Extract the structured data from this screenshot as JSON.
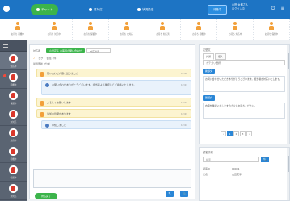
{
  "colors": {
    "topbar": "#1d74c4",
    "accent_green": "#3cb44b",
    "accent_blue": "#2a86d6",
    "person_icon": "#f2a03a",
    "rail": "#5a6472",
    "customer_bubble": "#fcf4d0",
    "agent_bubble": "#e9f2fb"
  },
  "topbar": {
    "tabs": [
      {
        "label": "チャット",
        "icon": "chat-icon"
      },
      {
        "label": "再対応",
        "icon": "person-icon"
      },
      {
        "label": "状況設定",
        "icon": "settings-icon"
      }
    ],
    "status_button": "待機中",
    "user_name": "山田 太郎さん",
    "user_sub": "ログイン中"
  },
  "queue": [
    {
      "label": "お待ち 待機中"
    },
    {
      "label": "お待ち 対応中"
    },
    {
      "label": "お待ち 保留中"
    },
    {
      "label": "お待ち 未対応"
    },
    {
      "label": "お待ち 対応済"
    },
    {
      "label": "お待ち 待機中"
    },
    {
      "label": "お待ち 対応中"
    },
    {
      "label": "お待ち 保留中"
    }
  ],
  "rail": {
    "items": [
      {
        "label": "対応中"
      },
      {
        "label": "待機中"
      },
      {
        "label": "保留中"
      },
      {
        "label": "未対応"
      },
      {
        "label": "対応中"
      },
      {
        "label": "待機中"
      },
      {
        "label": "保留中"
      },
      {
        "label": "未対応"
      }
    ]
  },
  "main": {
    "customer_id": "対応者",
    "customer_field": "山田花子 お客様の問い合わせ",
    "customer_select": "対応状況",
    "sub_left": "ログ",
    "sub_mid": "会話 3件",
    "sub2": "最終更新 2分前",
    "messages": [
      {
        "type": "customer",
        "text": "問い合わせ内容を送りました",
        "time": "12:00"
      },
      {
        "type": "agent",
        "text": "お問い合わせありがとうございます。担当者より確認してご連絡いたします。",
        "time": "12:01"
      },
      {
        "type": "customer",
        "text": "よろしくお願いします",
        "time": "12:02"
      },
      {
        "type": "customer",
        "text": "追加の質問があります",
        "time": "12:03"
      },
      {
        "type": "agent",
        "text": "承知しました",
        "time": "12:04"
      }
    ],
    "send_label": "✎",
    "attach_label": "📎",
    "bottom_button": "対応完了"
  },
  "right": {
    "title": "定型文",
    "tabs": [
      "共通",
      "個人"
    ],
    "select": "カテゴリ選択",
    "items": [
      {
        "button": "挨拶文",
        "text": "お問い合わせいただきありがとうございます。担当者が対応いたします。"
      },
      {
        "button": "確認文",
        "text": "内容を確認いたしますので少々お待ちください。"
      }
    ],
    "pager": [
      "‹",
      "1",
      "2",
      "3",
      "›"
    ]
  },
  "right2": {
    "title": "顧客情報",
    "search_placeholder": "検索",
    "search_btn": "🔍",
    "rows": [
      {
        "k": "顧客ID",
        "v": "00001"
      },
      {
        "k": "氏名",
        "v": "山田花子"
      }
    ]
  }
}
